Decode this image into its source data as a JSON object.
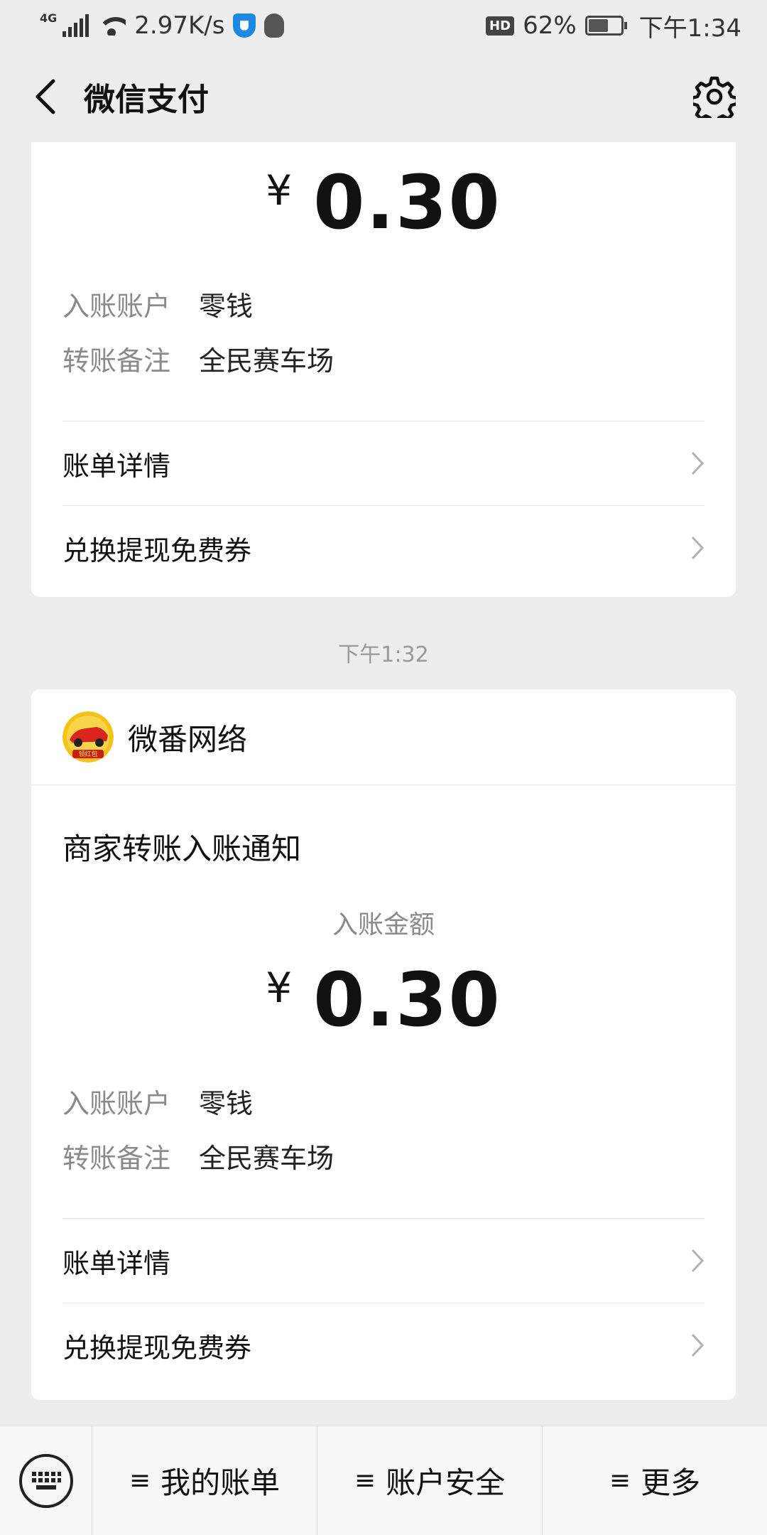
{
  "status_bar": {
    "network": "4G",
    "speed": "2.97K/s",
    "hd": "HD",
    "battery_level": "62%",
    "time": "下午1:34"
  },
  "nav": {
    "title": "微信支付"
  },
  "card1": {
    "currency": "¥",
    "amount": "0.30",
    "account_label": "入账账户",
    "account_value": "零钱",
    "remark_label": "转账备注",
    "remark_value": "全民赛车场",
    "bill_details": "账单详情",
    "coupon": "兑换提现免费券"
  },
  "timestamp": "下午1:32",
  "card2": {
    "merchant_name": "微番网络",
    "logo_text": "领红包",
    "notice_title": "商家转账入账通知",
    "amount_label": "入账金额",
    "currency": "¥",
    "amount": "0.30",
    "account_label": "入账账户",
    "account_value": "零钱",
    "remark_label": "转账备注",
    "remark_value": "全民赛车场",
    "bill_details": "账单详情",
    "coupon": "兑换提现免费券"
  },
  "bottom_menu": {
    "my_bills": "我的账单",
    "account_security": "账户安全",
    "more": "更多",
    "menu_glyph": "≡"
  },
  "colors": {
    "background": "#ededed",
    "card": "#ffffff",
    "secondary_text": "#8a8a8a"
  }
}
